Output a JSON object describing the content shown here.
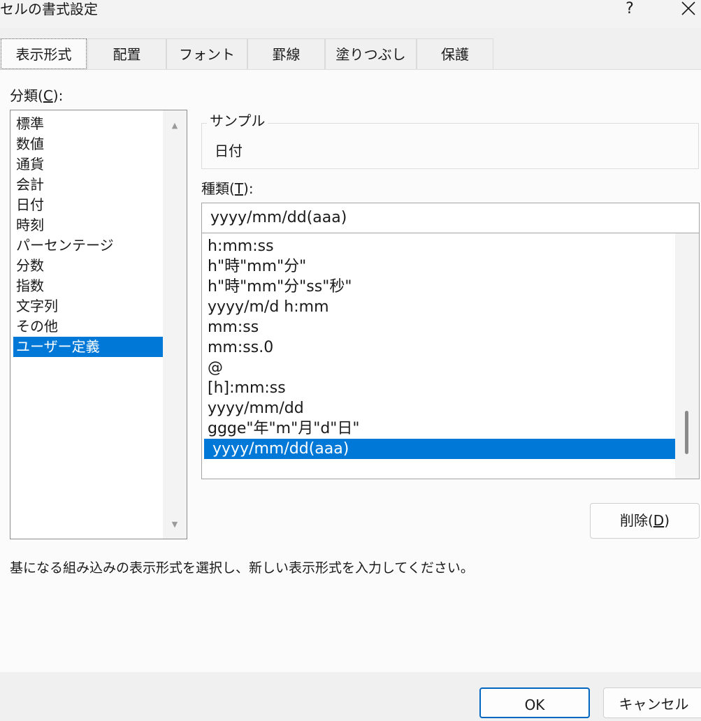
{
  "window": {
    "title": "セルの書式設定",
    "help_label": "?",
    "close_icon": "close-icon"
  },
  "tabs": [
    {
      "label": "表示形式",
      "active": true
    },
    {
      "label": "配置",
      "active": false
    },
    {
      "label": "フォント",
      "active": false
    },
    {
      "label": "罫線",
      "active": false
    },
    {
      "label": "塗りつぶし",
      "active": false
    },
    {
      "label": "保護",
      "active": false
    }
  ],
  "category": {
    "label_prefix": "分類(",
    "label_key": "C",
    "label_suffix": "):",
    "items": [
      {
        "label": "標準"
      },
      {
        "label": "数値"
      },
      {
        "label": "通貨"
      },
      {
        "label": "会計"
      },
      {
        "label": "日付"
      },
      {
        "label": "時刻"
      },
      {
        "label": "パーセンテージ"
      },
      {
        "label": "分数"
      },
      {
        "label": "指数"
      },
      {
        "label": "文字列"
      },
      {
        "label": "その他"
      },
      {
        "label": "ユーザー定義"
      }
    ],
    "selected": "ユーザー定義",
    "scroll_up_icon": "triangle-up-icon",
    "scroll_down_icon": "triangle-down-icon"
  },
  "sample": {
    "legend": "サンプル",
    "value": "日付"
  },
  "type": {
    "label_prefix": "種類(",
    "label_key": "T",
    "label_suffix": "):",
    "input_value": "yyyy/mm/dd(aaa)",
    "items": [
      {
        "label": "h:mm:ss"
      },
      {
        "label": "h\"時\"mm\"分\""
      },
      {
        "label": "h\"時\"mm\"分\"ss\"秒\""
      },
      {
        "label": "yyyy/m/d h:mm"
      },
      {
        "label": "mm:ss"
      },
      {
        "label": "mm:ss.0"
      },
      {
        "label": "@"
      },
      {
        "label": "[h]:mm:ss"
      },
      {
        "label": "yyyy/mm/dd"
      },
      {
        "label": "ggge\"年\"m\"月\"d\"日\""
      },
      {
        "label": "yyyy/mm/dd(aaa)"
      }
    ],
    "selected": "yyyy/mm/dd(aaa)"
  },
  "delete_button": {
    "prefix": "削除(",
    "key": "D",
    "suffix": ")"
  },
  "description": "基になる組み込みの表示形式を選択し、新しい表示形式を入力してください。",
  "footer": {
    "ok_label": "OK",
    "cancel_label": "キャンセル"
  },
  "colors": {
    "selection": "#0078d7",
    "ok_border": "#0067c0",
    "dialog_bg": "#f0f0f0"
  }
}
